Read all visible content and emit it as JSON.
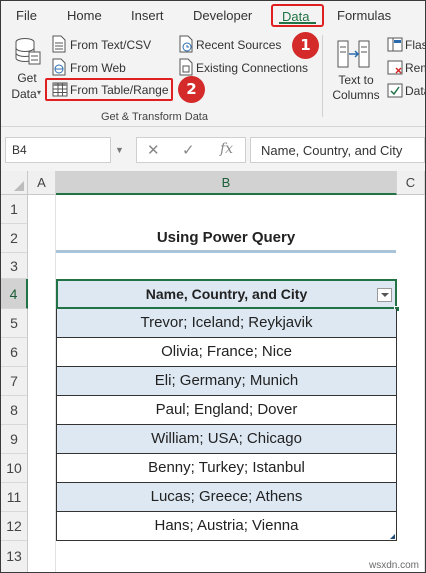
{
  "ribbon": {
    "tabs": [
      "File",
      "Home",
      "Insert",
      "Developer",
      "Data",
      "Formulas"
    ],
    "active_tab": "Data",
    "get_data": {
      "line1": "Get",
      "line2": "Data"
    },
    "commands": {
      "from_text_csv": "From Text/CSV",
      "from_web": "From Web",
      "from_table_range": "From Table/Range",
      "recent_sources": "Recent Sources",
      "existing_connections": "Existing Connections",
      "text_to_columns_line1": "Text to",
      "text_to_columns_line2": "Columns",
      "flash_fill": "Flas",
      "remove_duplicates": "Rem",
      "data_validation": "Data"
    },
    "group_label": "Get & Transform Data",
    "step_badges": [
      "1",
      "2"
    ]
  },
  "formula_bar": {
    "name_box": "B4",
    "cancel_icon": "✕",
    "enter_icon": "✓",
    "fx_label": "fx",
    "formula": "Name, Country, and City"
  },
  "grid": {
    "columns": [
      "A",
      "B",
      "C"
    ],
    "selected_column": "B",
    "rows": [
      "1",
      "2",
      "3",
      "4",
      "5",
      "6",
      "7",
      "8",
      "9",
      "10",
      "11",
      "12",
      "13"
    ],
    "selected_row": "4",
    "title": "Using Power Query",
    "table": {
      "header": "Name, Country, and City",
      "rows": [
        "Trevor; Iceland; Reykjavik",
        "Olivia; France; Nice",
        "Eli; Germany; Munich",
        "Paul; England; Dover",
        "William; USA; Chicago",
        "Benny; Turkey; Istanbul",
        "Lucas; Greece; Athens",
        "Hans; Austria; Vienna"
      ]
    }
  },
  "watermark": "wsxdn.com",
  "colors": {
    "accent": "#217346",
    "highlight": "#e02020",
    "table_band": "#dde8f3"
  }
}
